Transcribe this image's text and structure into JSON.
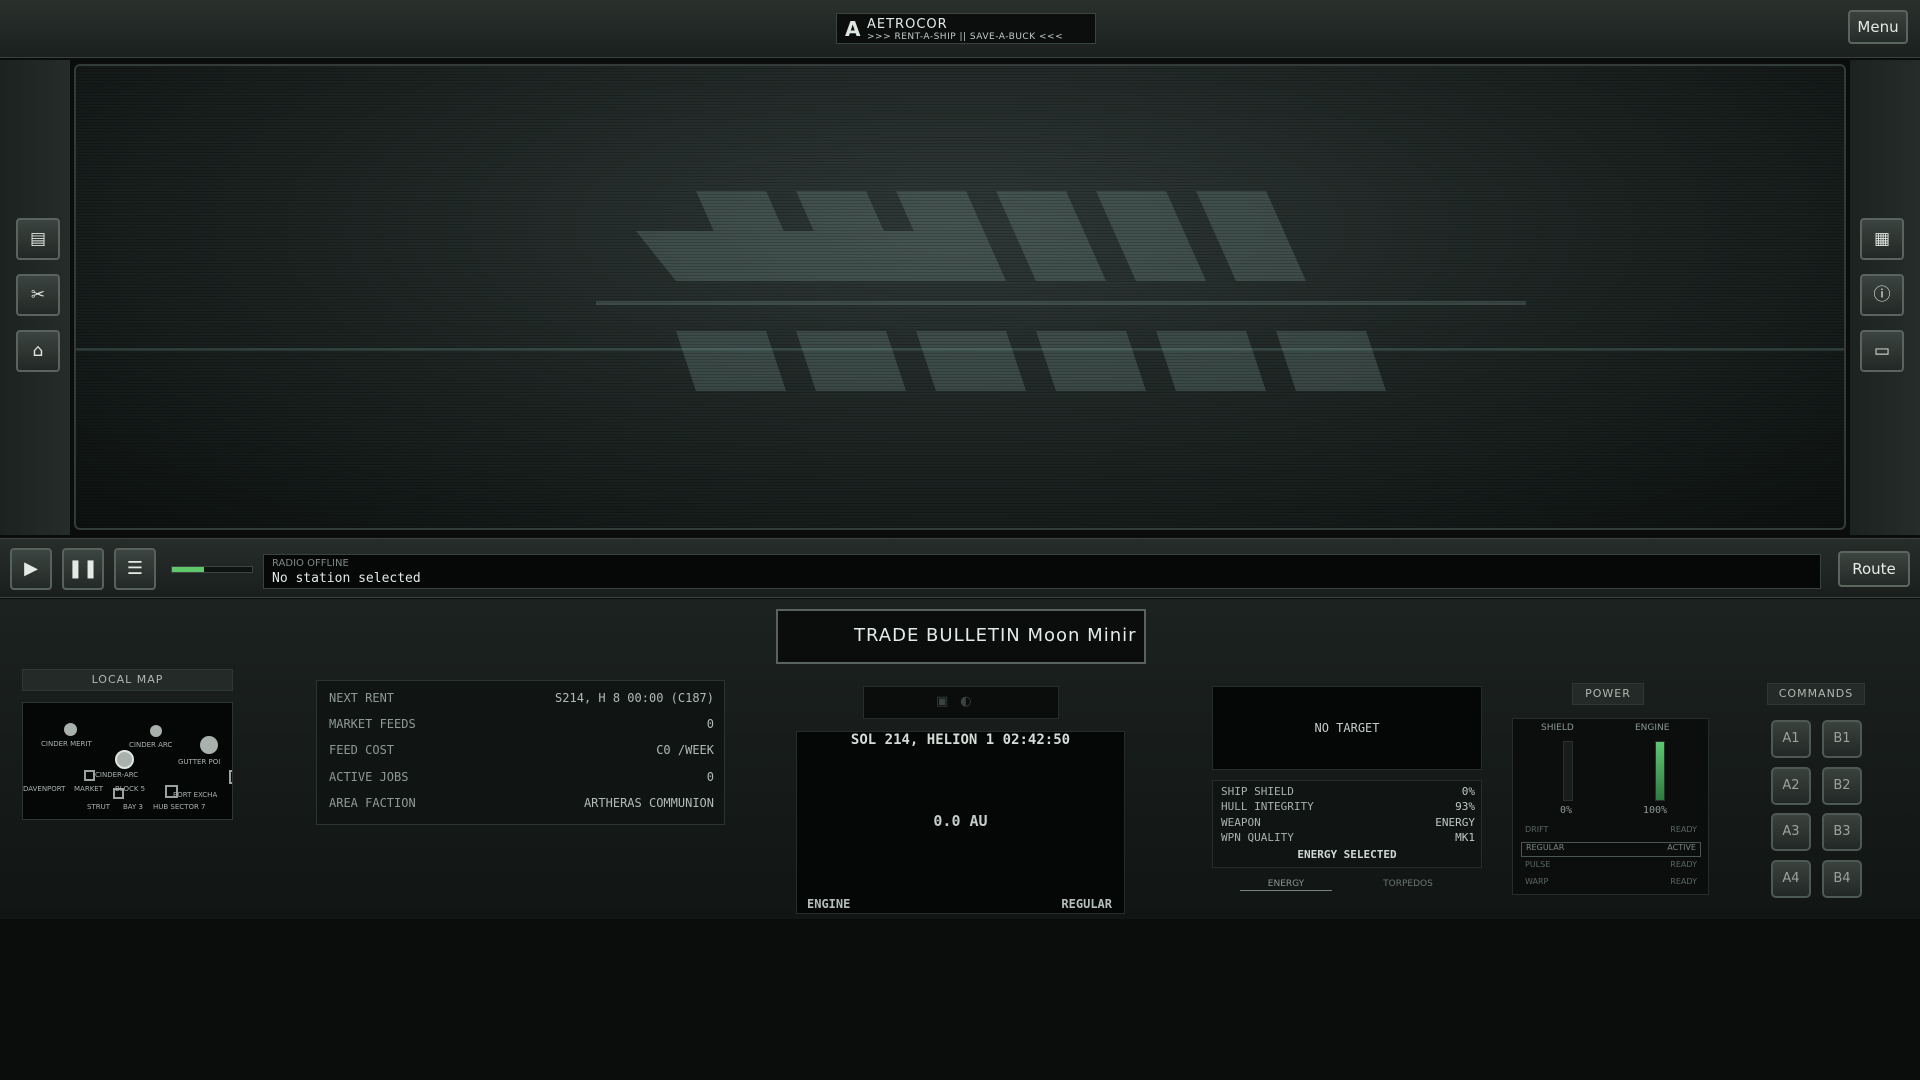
{
  "header": {
    "brand_name": "AETROCOR",
    "brand_tagline": ">>> RENT-A-SHIP || SAVE-A-BUCK <<<",
    "menu_label": "Menu"
  },
  "left_toolbar": [
    {
      "icon": "clipboard-icon"
    },
    {
      "icon": "tools-icon"
    },
    {
      "icon": "shop-icon"
    }
  ],
  "right_toolbar": [
    {
      "icon": "cargo-icon"
    },
    {
      "icon": "info-icon"
    },
    {
      "icon": "chat-icon"
    }
  ],
  "controls": {
    "play_icon": "play-icon",
    "pause_icon": "pause-icon",
    "list_icon": "list-icon",
    "volume_level": 0.4,
    "radio_status": "RADIO OFFLINE",
    "radio_message": "No station selected",
    "route_label": "Route"
  },
  "bulletin": {
    "text": "TRADE BULLETIN Moon Minir"
  },
  "local_map": {
    "title": "LOCAL MAP",
    "labels": [
      "CINDER MERIT",
      "CINDER ARC",
      "GUTTER POI",
      "CINDER-ARC",
      "DAVENPORT",
      "MARKET",
      "BLOCK 5",
      "PORT EXCHA",
      "STRUT",
      "BAY 3",
      "HUB SECTOR 7"
    ]
  },
  "info": {
    "rows": [
      {
        "k": "NEXT RENT",
        "v": "S214, H 8 00:00 (C187)"
      },
      {
        "k": "MARKET FEEDS",
        "v": "0"
      },
      {
        "k": "FEED COST",
        "v": "C0 /WEEK"
      },
      {
        "k": "ACTIVE JOBS",
        "v": "0"
      },
      {
        "k": "AREA FACTION",
        "v": "ARTHERAS COMMUNION"
      }
    ]
  },
  "navigation": {
    "datetime": "SOL 214, HELION 1 02:42:50",
    "distance": "0.0 AU",
    "engine_label": "ENGINE",
    "engine_mode": "REGULAR"
  },
  "target": {
    "text": "NO TARGET"
  },
  "weapons": {
    "rows": [
      {
        "k": "SHIP SHIELD",
        "v": "0%"
      },
      {
        "k": "HULL INTEGRITY",
        "v": "93%"
      },
      {
        "k": "WEAPON",
        "v": "ENERGY"
      },
      {
        "k": "WPN QUALITY",
        "v": "MK1"
      }
    ],
    "selected": "ENERGY SELECTED",
    "tabs": [
      "ENERGY",
      "TORPEDOS"
    ]
  },
  "power": {
    "title": "POWER",
    "shield_label": "SHIELD",
    "engine_label": "ENGINE",
    "shield_pct": "0%",
    "engine_pct": "100%",
    "shield_level": 0.0,
    "engine_level": 1.0,
    "modes": [
      {
        "k": "DRIFT",
        "v": "READY"
      },
      {
        "k": "REGULAR",
        "v": "ACTIVE"
      },
      {
        "k": "PULSE",
        "v": "READY"
      },
      {
        "k": "WARP",
        "v": "READY"
      }
    ]
  },
  "commands": {
    "title": "COMMANDS",
    "buttons": [
      "A1",
      "B1",
      "A2",
      "B2",
      "A3",
      "B3",
      "A4",
      "B4"
    ]
  }
}
